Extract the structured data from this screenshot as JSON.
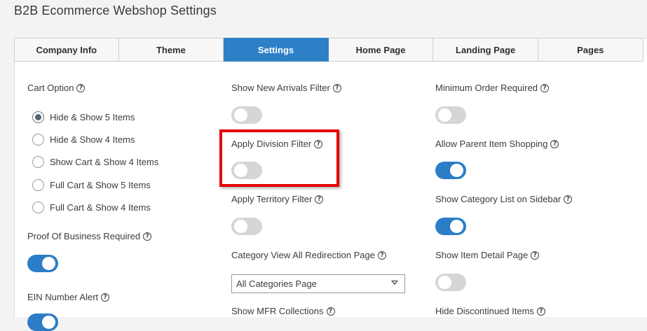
{
  "page": {
    "title": "B2B Ecommerce Webshop Settings"
  },
  "tabs": [
    {
      "label": "Company Info",
      "active": false
    },
    {
      "label": "Theme",
      "active": false
    },
    {
      "label": "Settings",
      "active": true
    },
    {
      "label": "Home Page",
      "active": false
    },
    {
      "label": "Landing Page",
      "active": false
    },
    {
      "label": "Pages",
      "active": false
    }
  ],
  "colors": {
    "accent": "#2e80c7",
    "toggle_on": "#2b7dc8",
    "toggle_off": "#d6d6d6",
    "highlight": "#e50000"
  },
  "icons": {
    "help": "question-circle-icon",
    "dropdown": "caret-down-icon"
  },
  "help_glyph": "?",
  "col1": {
    "cart_option_label": "Cart Option",
    "cart_options": [
      {
        "label": "Hide & Show 5 Items",
        "selected": true
      },
      {
        "label": "Hide & Show 4 Items",
        "selected": false
      },
      {
        "label": "Show Cart & Show 4 Items",
        "selected": false
      },
      {
        "label": "Full Cart & Show 5 Items",
        "selected": false
      },
      {
        "label": "Full Cart & Show 4 Items",
        "selected": false
      }
    ],
    "proof_label": "Proof Of Business Required",
    "proof_on": true,
    "ein_label": "EIN Number Alert"
  },
  "col2": {
    "new_arrivals_label": "Show New Arrivals Filter",
    "new_arrivals_on": false,
    "division_label": "Apply Division Filter",
    "division_on": false,
    "territory_label": "Apply Territory Filter",
    "territory_on": false,
    "category_redirect_label": "Category View All Redirection Page",
    "category_redirect_value": "All Categories Page",
    "mfr_label": "Show MFR Collections"
  },
  "col3": {
    "min_order_label": "Minimum Order Required",
    "min_order_on": false,
    "parent_item_label": "Allow Parent Item Shopping",
    "parent_item_on": true,
    "category_sidebar_label": "Show Category List on Sidebar",
    "category_sidebar_on": true,
    "item_detail_label": "Show Item Detail Page",
    "item_detail_on": false,
    "discontinued_label": "Hide Discontinued Items"
  }
}
